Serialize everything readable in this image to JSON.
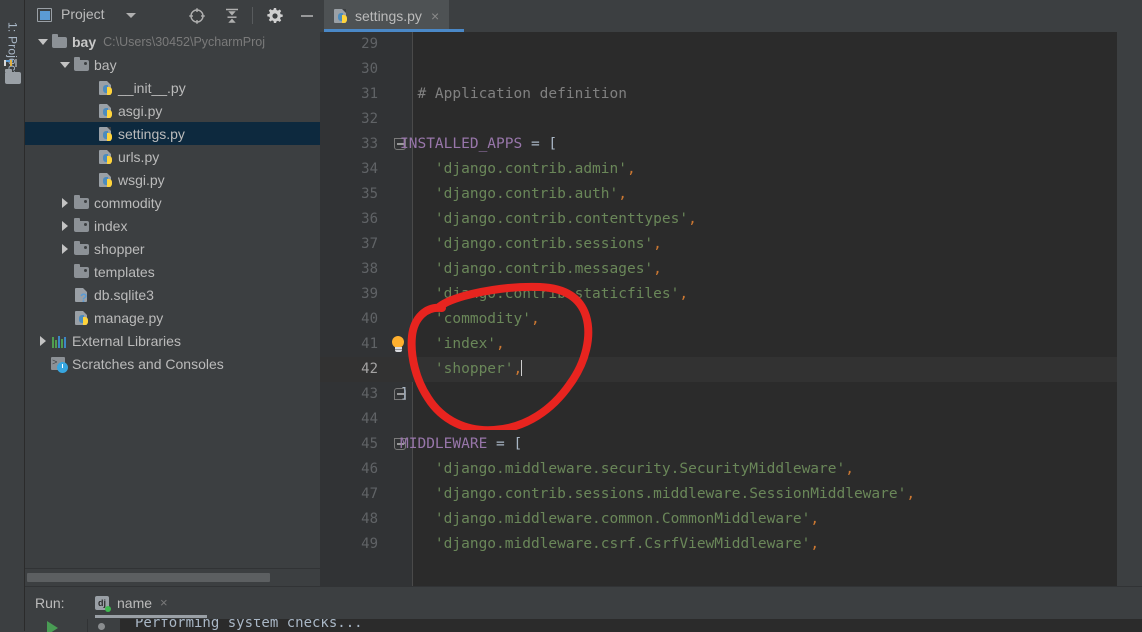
{
  "window": {
    "tool_stripe_label": "1: Project"
  },
  "project_panel": {
    "title": "Project",
    "toolbar": [
      {
        "name": "locate-icon",
        "tip": "Select Opened File"
      },
      {
        "name": "collapse-all-icon",
        "tip": "Collapse All"
      },
      {
        "name": "gear-icon",
        "tip": "Settings"
      },
      {
        "name": "minimize-icon",
        "tip": "Hide"
      }
    ],
    "tree": [
      {
        "label": "bay",
        "path": "C:\\Users\\30452\\PycharmProj",
        "icon": "folder-icon",
        "indent": 0,
        "twisty": "down",
        "bold": true,
        "selected": false
      },
      {
        "label": "bay",
        "path": "",
        "icon": "folder-src-icon",
        "indent": 1,
        "twisty": "down",
        "bold": false,
        "selected": false
      },
      {
        "label": "__init__.py",
        "path": "",
        "icon": "python-file-icon",
        "indent": 2,
        "twisty": "none",
        "bold": false,
        "selected": false
      },
      {
        "label": "asgi.py",
        "path": "",
        "icon": "python-file-icon",
        "indent": 2,
        "twisty": "none",
        "bold": false,
        "selected": false
      },
      {
        "label": "settings.py",
        "path": "",
        "icon": "python-file-icon",
        "indent": 2,
        "twisty": "none",
        "bold": false,
        "selected": true
      },
      {
        "label": "urls.py",
        "path": "",
        "icon": "python-file-icon",
        "indent": 2,
        "twisty": "none",
        "bold": false,
        "selected": false
      },
      {
        "label": "wsgi.py",
        "path": "",
        "icon": "python-file-icon",
        "indent": 2,
        "twisty": "none",
        "bold": false,
        "selected": false
      },
      {
        "label": "commodity",
        "path": "",
        "icon": "folder-src-icon",
        "indent": 1,
        "twisty": "right",
        "bold": false,
        "selected": false
      },
      {
        "label": "index",
        "path": "",
        "icon": "folder-src-icon",
        "indent": 1,
        "twisty": "right",
        "bold": false,
        "selected": false
      },
      {
        "label": "shopper",
        "path": "",
        "icon": "folder-src-icon",
        "indent": 1,
        "twisty": "right",
        "bold": false,
        "selected": false
      },
      {
        "label": "templates",
        "path": "",
        "icon": "folder-src-icon",
        "indent": 1,
        "twisty": "none",
        "bold": false,
        "selected": false
      },
      {
        "label": "db.sqlite3",
        "path": "",
        "icon": "unknown-file-icon",
        "indent": 1,
        "twisty": "none",
        "bold": false,
        "selected": false
      },
      {
        "label": "manage.py",
        "path": "",
        "icon": "python-file-icon",
        "indent": 1,
        "twisty": "none",
        "bold": false,
        "selected": false
      },
      {
        "label": "External Libraries",
        "path": "",
        "icon": "libraries-icon",
        "indent": 0,
        "twisty": "right",
        "bold": false,
        "selected": false
      },
      {
        "label": "Scratches and Consoles",
        "path": "",
        "icon": "scratches-icon",
        "indent": 0,
        "twisty": "none",
        "bold": false,
        "selected": false
      }
    ]
  },
  "editor": {
    "tabs": [
      {
        "label": "settings.py",
        "icon": "python-file-icon",
        "active": true,
        "close": "×"
      }
    ],
    "first_line": 29,
    "current_line": 42,
    "lines": [
      {
        "n": 29,
        "segments": []
      },
      {
        "n": 30,
        "segments": []
      },
      {
        "n": 31,
        "segments": [
          {
            "t": "  # Application definition",
            "c": "com"
          }
        ]
      },
      {
        "n": 32,
        "segments": []
      },
      {
        "n": 33,
        "segments": [
          {
            "t": "INSTALLED_APPS",
            "c": "const"
          },
          {
            "t": " = [",
            "c": "punc"
          }
        ],
        "fold": "start"
      },
      {
        "n": 34,
        "segments": [
          {
            "t": "    ",
            "c": "punc"
          },
          {
            "t": "'django.contrib.admin'",
            "c": "str"
          },
          {
            "t": ",",
            "c": "comma"
          }
        ]
      },
      {
        "n": 35,
        "segments": [
          {
            "t": "    ",
            "c": "punc"
          },
          {
            "t": "'django.contrib.auth'",
            "c": "str"
          },
          {
            "t": ",",
            "c": "comma"
          }
        ]
      },
      {
        "n": 36,
        "segments": [
          {
            "t": "    ",
            "c": "punc"
          },
          {
            "t": "'django.contrib.contenttypes'",
            "c": "str"
          },
          {
            "t": ",",
            "c": "comma"
          }
        ]
      },
      {
        "n": 37,
        "segments": [
          {
            "t": "    ",
            "c": "punc"
          },
          {
            "t": "'django.contrib.sessions'",
            "c": "str"
          },
          {
            "t": ",",
            "c": "comma"
          }
        ]
      },
      {
        "n": 38,
        "segments": [
          {
            "t": "    ",
            "c": "punc"
          },
          {
            "t": "'django.contrib.messages'",
            "c": "str"
          },
          {
            "t": ",",
            "c": "comma"
          }
        ]
      },
      {
        "n": 39,
        "segments": [
          {
            "t": "    ",
            "c": "punc"
          },
          {
            "t": "'django.contrib.staticfiles'",
            "c": "str"
          },
          {
            "t": ",",
            "c": "comma"
          }
        ]
      },
      {
        "n": 40,
        "segments": [
          {
            "t": "    ",
            "c": "punc"
          },
          {
            "t": "'commodity'",
            "c": "str"
          },
          {
            "t": ",",
            "c": "comma"
          }
        ]
      },
      {
        "n": 41,
        "segments": [
          {
            "t": "    ",
            "c": "punc"
          },
          {
            "t": "'index'",
            "c": "str"
          },
          {
            "t": ",",
            "c": "comma"
          }
        ],
        "bulb": true
      },
      {
        "n": 42,
        "segments": [
          {
            "t": "    ",
            "c": "punc"
          },
          {
            "t": "'shopper'",
            "c": "str"
          },
          {
            "t": ",",
            "c": "comma"
          }
        ],
        "caret": true
      },
      {
        "n": 43,
        "segments": [
          {
            "t": "]",
            "c": "punc"
          }
        ],
        "fold": "end"
      },
      {
        "n": 44,
        "segments": []
      },
      {
        "n": 45,
        "segments": [
          {
            "t": "MIDDLEWARE",
            "c": "const"
          },
          {
            "t": " = [",
            "c": "punc"
          }
        ],
        "fold": "start"
      },
      {
        "n": 46,
        "segments": [
          {
            "t": "    ",
            "c": "punc"
          },
          {
            "t": "'django.middleware.security.SecurityMiddleware'",
            "c": "str"
          },
          {
            "t": ",",
            "c": "comma"
          }
        ]
      },
      {
        "n": 47,
        "segments": [
          {
            "t": "    ",
            "c": "punc"
          },
          {
            "t": "'django.contrib.sessions.middleware.SessionMiddleware'",
            "c": "str"
          },
          {
            "t": ",",
            "c": "comma"
          }
        ]
      },
      {
        "n": 48,
        "segments": [
          {
            "t": "    ",
            "c": "punc"
          },
          {
            "t": "'django.middleware.common.CommonMiddleware'",
            "c": "str"
          },
          {
            "t": ",",
            "c": "comma"
          }
        ]
      },
      {
        "n": 49,
        "segments": [
          {
            "t": "    ",
            "c": "punc"
          },
          {
            "t": "'django.middleware.csrf.CsrfViewMiddleware'",
            "c": "str"
          },
          {
            "t": ",",
            "c": "comma"
          }
        ]
      }
    ]
  },
  "annotation": {
    "shape": "hand-drawn-red-circle",
    "color": "#e8241f",
    "encircles": "installed-apps-custom-entries"
  },
  "run_panel": {
    "label": "Run:",
    "tab_label": "name",
    "tab_icon": "django-icon",
    "tab_close": "×",
    "status_dot_color": "#3fb950",
    "console_text": "Performing system checks..."
  },
  "colors": {
    "background": "#3c3f41",
    "editor_background": "#2b2b2b",
    "gutter": "#313335",
    "selection": "#0d293e",
    "accent": "#4a88c7",
    "string": "#6a8759",
    "comment": "#808080",
    "constant": "#9876aa",
    "comma": "#cc7832",
    "annotation_red": "#e8241f"
  }
}
